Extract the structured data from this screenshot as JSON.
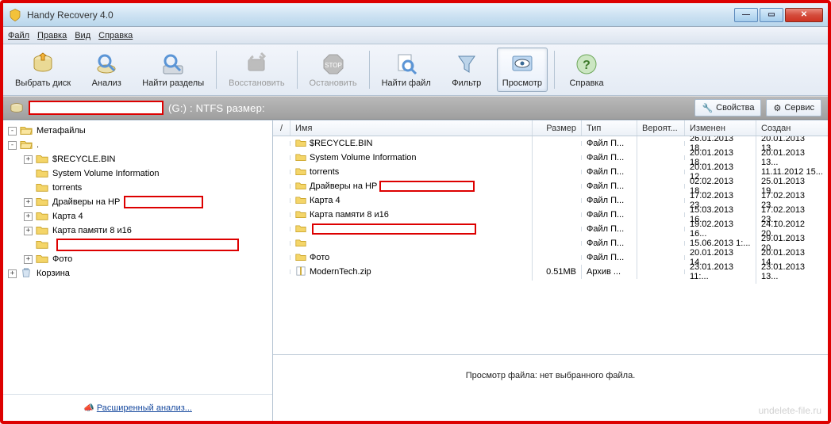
{
  "title": "Handy Recovery 4.0",
  "menu": [
    "Файл",
    "Правка",
    "Вид",
    "Справка"
  ],
  "toolbar": [
    {
      "id": "select-disk",
      "label": "Выбрать диск",
      "kind": "disk"
    },
    {
      "id": "analyze",
      "label": "Анализ",
      "kind": "analyze"
    },
    {
      "id": "find-partitions",
      "label": "Найти разделы",
      "kind": "find-part"
    },
    {
      "id": "sep"
    },
    {
      "id": "recover",
      "label": "Восстановить",
      "kind": "recover",
      "disabled": true
    },
    {
      "id": "sep"
    },
    {
      "id": "stop",
      "label": "Остановить",
      "kind": "stop",
      "disabled": true
    },
    {
      "id": "sep"
    },
    {
      "id": "find-file",
      "label": "Найти файл",
      "kind": "find-file"
    },
    {
      "id": "filter",
      "label": "Фильтр",
      "kind": "filter"
    },
    {
      "id": "preview",
      "label": "Просмотр",
      "kind": "preview",
      "active": true
    },
    {
      "id": "sep"
    },
    {
      "id": "help",
      "label": "Справка",
      "kind": "help"
    }
  ],
  "pathbar": {
    "redacted_drive_suffix": "(G:) : NTFS размер:",
    "buttons": {
      "props": "Свойства",
      "service": "Сервис"
    }
  },
  "tree": [
    {
      "level": 0,
      "toggle": "-",
      "label": "Метафайлы",
      "kind": "meta"
    },
    {
      "level": 0,
      "toggle": "-",
      "label": ".",
      "kind": "folder-open"
    },
    {
      "level": 1,
      "toggle": "+",
      "label": "$RECYCLE.BIN",
      "kind": "folder"
    },
    {
      "level": 1,
      "toggle": "",
      "label": "System Volume Information",
      "kind": "folder"
    },
    {
      "level": 1,
      "toggle": "",
      "label": "torrents",
      "kind": "folder"
    },
    {
      "level": 1,
      "toggle": "+",
      "label": "Драйверы на HP",
      "kind": "folder",
      "redact": 100
    },
    {
      "level": 1,
      "toggle": "+",
      "label": "Карта 4",
      "kind": "folder"
    },
    {
      "level": 1,
      "toggle": "+",
      "label": "Карта памяти 8 и16",
      "kind": "folder"
    },
    {
      "level": 1,
      "toggle": "",
      "label": "",
      "kind": "folder",
      "redact": 230
    },
    {
      "level": 1,
      "toggle": "+",
      "label": "Фото",
      "kind": "folder"
    },
    {
      "level": 0,
      "toggle": "+",
      "label": "Корзина",
      "kind": "bin"
    }
  ],
  "list": {
    "headers": {
      "chk": "/",
      "name": "Имя",
      "size": "Размер",
      "type": "Тип",
      "prob": "Вероят...",
      "mod": "Изменен",
      "crt": "Создан"
    },
    "rows": [
      {
        "name": "$RECYCLE.BIN",
        "icon": "folder",
        "size": "",
        "type": "Файл П...",
        "prob": "",
        "mod": "26.01.2013 18...",
        "crt": "20.01.2013 13..."
      },
      {
        "name": "System Volume Information",
        "icon": "folder",
        "size": "",
        "type": "Файл П...",
        "prob": "",
        "mod": "20.01.2013 18...",
        "crt": "20.01.2013 13..."
      },
      {
        "name": "torrents",
        "icon": "folder",
        "size": "",
        "type": "Файл П...",
        "prob": "",
        "mod": "20.01.2013 12...",
        "crt": "11.11.2012 15..."
      },
      {
        "name": "Драйверы на HP",
        "icon": "folder",
        "size": "",
        "type": "Файл П...",
        "prob": "",
        "mod": "02.02.2013 18...",
        "crt": "25.01.2013 19...",
        "redact": 120
      },
      {
        "name": "Карта 4",
        "icon": "folder",
        "size": "",
        "type": "Файл П...",
        "prob": "",
        "mod": "17.02.2013 23...",
        "crt": "17.02.2013 23..."
      },
      {
        "name": "Карта памяти 8 и16",
        "icon": "folder",
        "size": "",
        "type": "Файл П...",
        "prob": "",
        "mod": "15.03.2013 16...",
        "crt": "17.02.2013 23..."
      },
      {
        "name": "",
        "icon": "folder",
        "size": "",
        "type": "Файл П...",
        "prob": "",
        "mod": "19.02.2013 16...",
        "crt": "24.10.2012 20...",
        "redact": 207
      },
      {
        "name": "",
        "icon": "folder",
        "size": "",
        "type": "Файл П...",
        "prob": "",
        "mod": "15.06.2013 1:...",
        "crt": "29.01.2013 20..."
      },
      {
        "name": "Фото",
        "icon": "folder",
        "size": "",
        "type": "Файл П...",
        "prob": "",
        "mod": "20.01.2013 14...",
        "crt": "20.01.2013 14..."
      },
      {
        "name": "ModernTech.zip",
        "icon": "zip",
        "size": "0.51MB",
        "type": "Архив ...",
        "prob": "",
        "mod": "23.01.2013 11:...",
        "crt": "23.01.2013 13..."
      }
    ]
  },
  "preview_text": "Просмотр файла: нет выбранного файла.",
  "advanced_analysis": "Расширенный анализ...",
  "watermark": "undelete-file.ru"
}
